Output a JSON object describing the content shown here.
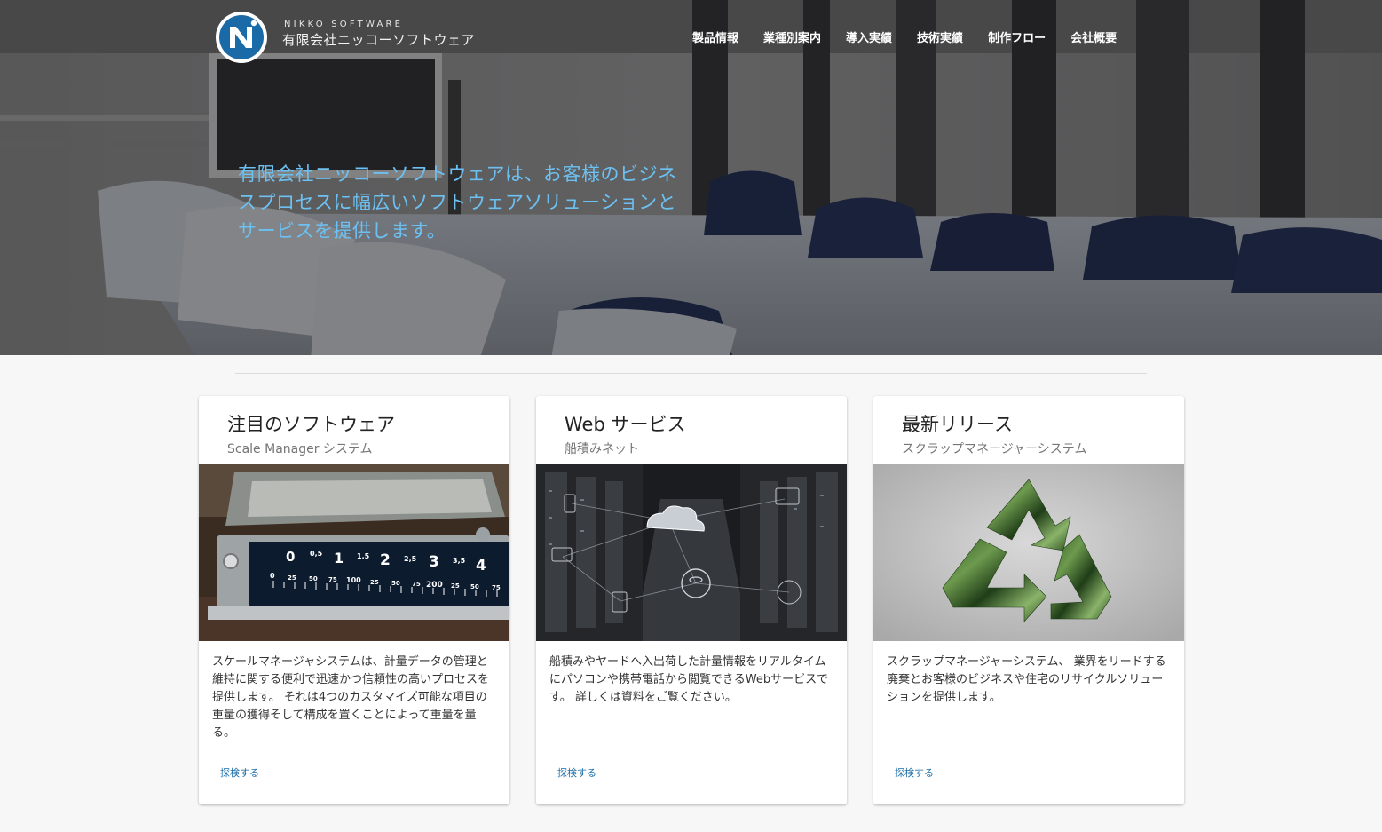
{
  "brand": {
    "name_en": "NIKKO SOFTWARE",
    "name_jp": "有限会社ニッコーソフトウェア",
    "logo_letter": "N"
  },
  "nav": {
    "items": [
      {
        "label": "製品情報"
      },
      {
        "label": "業種別案内"
      },
      {
        "label": "導入実績"
      },
      {
        "label": "技術実績"
      },
      {
        "label": "制作フロー"
      },
      {
        "label": "会社概要"
      }
    ]
  },
  "hero": {
    "tagline": "有限会社ニッコーソフトウェアは、お客様のビジネスプロセスに幅広いソフトウェアソリューションとサービスを提供します。"
  },
  "cards": [
    {
      "title": "注目のソフトウェア",
      "subtitle": "Scale Manager システム",
      "text": "スケールマネージャシステムは、計量データの管理と維持に関する便利で迅速かつ信頼性の高いプロセスを提供します。 それは4つのカスタマイズ可能な項目の重量の獲得そして構成を置くことによって重量を量る。",
      "action": "探検する",
      "media_icon": "scale-ruler-image"
    },
    {
      "title": "Web サービス",
      "subtitle": "船積みネット",
      "text": "船積みやヤードへ入出荷した計量情報をリアルタイムにパソコンや携帯電話から閲覧できるWebサービスです。 詳しくは資料をご覧ください。",
      "action": "探検する",
      "media_icon": "server-cloud-image"
    },
    {
      "title": "最新リリース",
      "subtitle": "スクラップマネージャーシステム",
      "text": "スクラップマネージャーシステム、 業界をリードする廃棄とお客様のビジネスや住宅のリサイクルソリューションを提供します。",
      "action": "探検する",
      "media_icon": "recycle-symbol-image"
    }
  ],
  "colors": {
    "tagline": "#6cc1f2",
    "link": "#1b6ea8",
    "logo_blue": "#1a6aa8"
  }
}
